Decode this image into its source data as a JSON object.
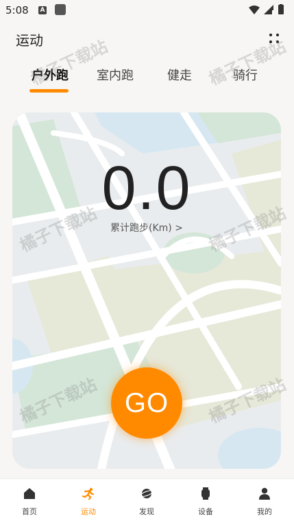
{
  "status_bar": {
    "time": "5:08",
    "notif_letter": "A"
  },
  "header": {
    "title": "运动",
    "menu_icon": "grid-dots-icon"
  },
  "tabs": [
    {
      "label": "户外跑",
      "active": true
    },
    {
      "label": "室内跑",
      "active": false
    },
    {
      "label": "健走",
      "active": false
    },
    {
      "label": "骑行",
      "active": false
    }
  ],
  "stats": {
    "distance": "0.0",
    "distance_label": "累计跑步(Km) >"
  },
  "go_button": {
    "label": "GO"
  },
  "watermark": "橘子下载站",
  "bottom_nav": [
    {
      "label": "首页",
      "icon": "home-icon",
      "active": false
    },
    {
      "label": "运动",
      "icon": "runner-icon",
      "active": true
    },
    {
      "label": "发现",
      "icon": "planet-icon",
      "active": false
    },
    {
      "label": "设备",
      "icon": "watch-icon",
      "active": false
    },
    {
      "label": "我的",
      "icon": "user-icon",
      "active": false
    }
  ],
  "colors": {
    "accent": "#ff8a00",
    "background": "#f7f6f4"
  }
}
